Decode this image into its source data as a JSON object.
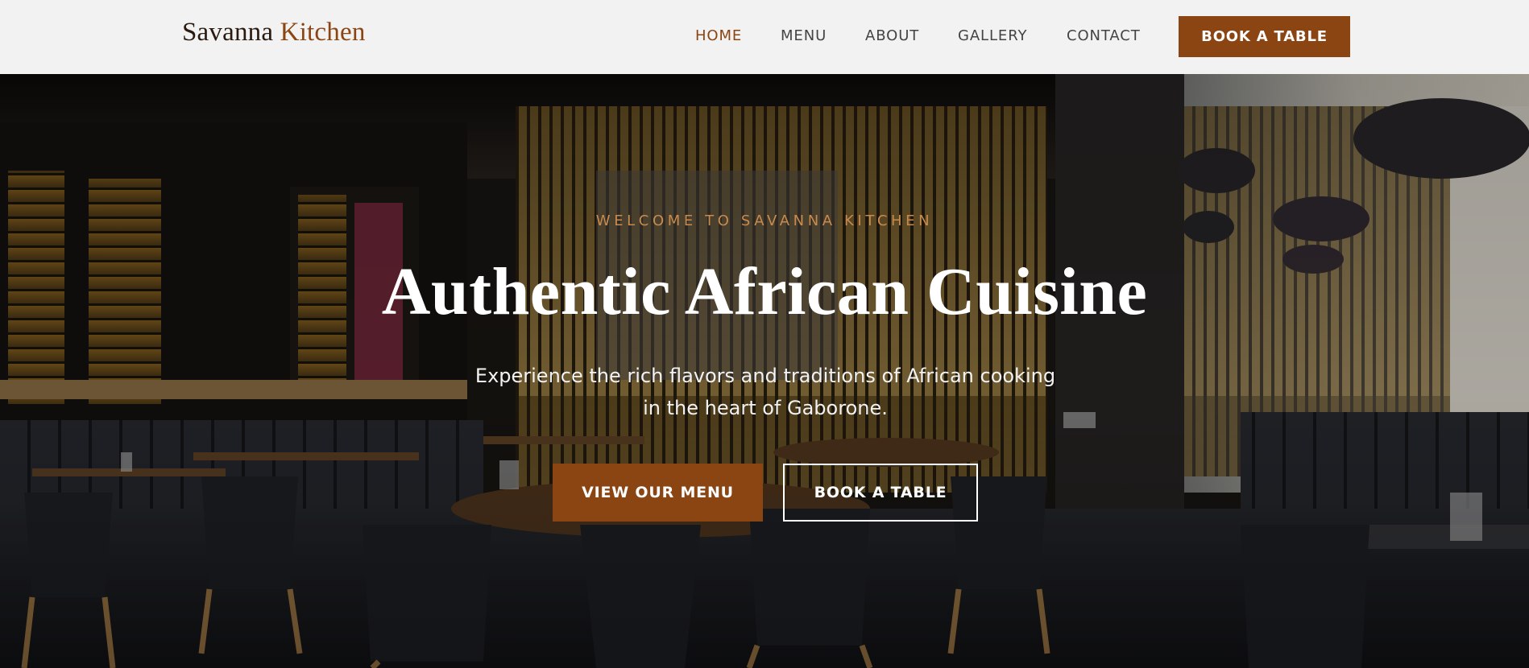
{
  "brand": {
    "name_part1": "Savanna",
    "name_part2": "Kitchen"
  },
  "nav": {
    "items": [
      {
        "label": "HOME",
        "active": true
      },
      {
        "label": "MENU",
        "active": false
      },
      {
        "label": "ABOUT",
        "active": false
      },
      {
        "label": "GALLERY",
        "active": false
      },
      {
        "label": "CONTACT",
        "active": false
      }
    ],
    "cta_label": "BOOK A TABLE"
  },
  "hero": {
    "eyebrow": "WELCOME TO SAVANNA KITCHEN",
    "headline": "Authentic African Cuisine",
    "subtitle_line1": "Experience the rich flavors and traditions of African cooking",
    "subtitle_line2": "in the heart of Gaborone.",
    "primary_button": "VIEW OUR MENU",
    "secondary_button": "BOOK A TABLE"
  },
  "colors": {
    "accent": "#8b4513",
    "eyebrow": "#c98a4e",
    "nav_bg": "#f2f2f2",
    "nav_text": "#444444"
  }
}
